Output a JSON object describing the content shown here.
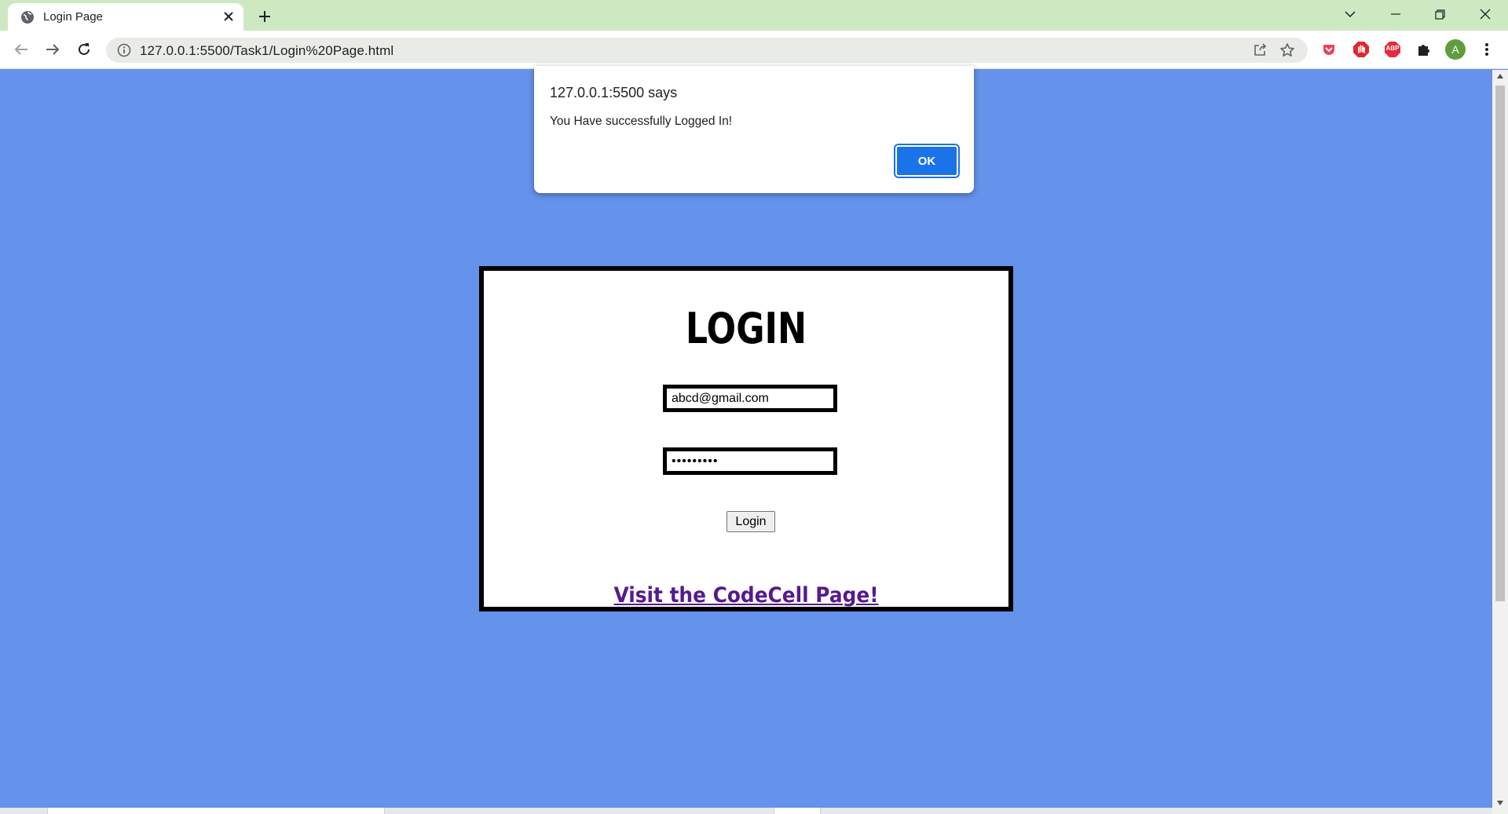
{
  "browser": {
    "tab_title": "Login Page",
    "url": "127.0.0.1:5500/Task1/Login%20Page.html",
    "profile_initial": "A",
    "abp_label": "ABP"
  },
  "page": {
    "background_color": "#6592EA",
    "login_title": "LOGIN",
    "email_value": "abcd@gmail.com",
    "password_value": "•••••••••",
    "login_button_label": "Login",
    "visit_link_text": "Visit the CodeCell Page!",
    "visit_link_color": "#551A8B"
  },
  "alert": {
    "title": "127.0.0.1:5500 says",
    "message": "You Have successfully Logged In!",
    "ok_label": "OK",
    "ok_color": "#1A73E8"
  }
}
